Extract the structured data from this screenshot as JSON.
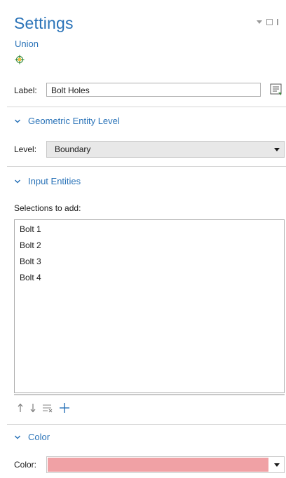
{
  "header": {
    "title": "Settings",
    "subtitle": "Union",
    "node_icon": "union-node-icon",
    "window_controls": [
      "dropdown-arrow-icon",
      "maximize-icon",
      "pin-icon"
    ]
  },
  "label_row": {
    "label": "Label:",
    "value": "Bolt Holes",
    "note_icon": "note-icon"
  },
  "geometric_entity_level": {
    "heading": "Geometric Entity Level",
    "level_label": "Level:",
    "level_value": "Boundary"
  },
  "input_entities": {
    "heading": "Input Entities",
    "selections_label": "Selections to add:",
    "items": [
      "Bolt 1",
      "Bolt 2",
      "Bolt 3",
      "Bolt 4"
    ],
    "toolbar_icons": [
      "move-up-icon",
      "move-down-icon",
      "clear-list-icon",
      "add-icon"
    ]
  },
  "color_section": {
    "heading": "Color",
    "color_label": "Color:",
    "color_value": "#f0a1a5"
  },
  "colors": {
    "accent": "#2a73b8",
    "separator": "#d6d6d6",
    "combo_bg": "#e8e8e8"
  }
}
